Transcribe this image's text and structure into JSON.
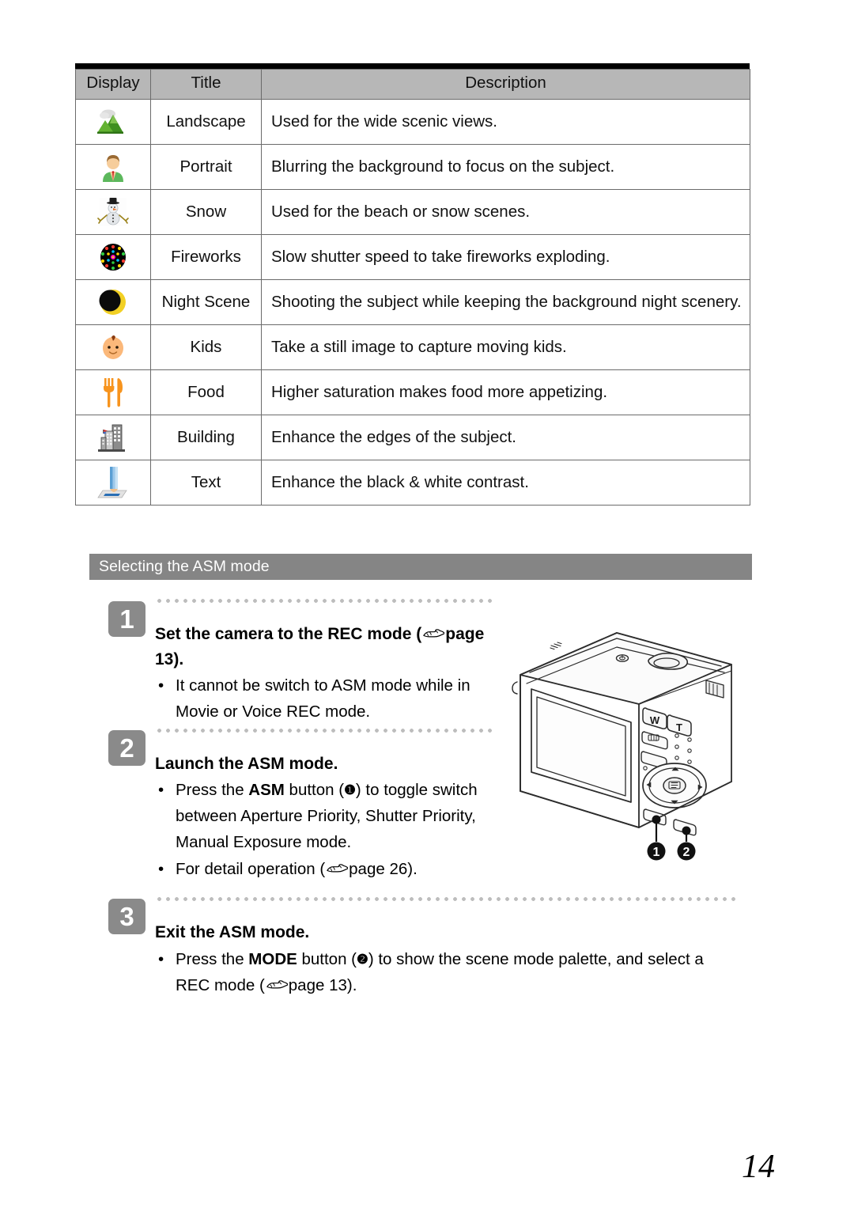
{
  "table": {
    "columns": [
      "Display",
      "Title",
      "Description"
    ],
    "rows": [
      {
        "icon": "landscape-icon",
        "title": "Landscape",
        "description": "Used for the wide scenic views."
      },
      {
        "icon": "portrait-icon",
        "title": "Portrait",
        "description": "Blurring the background to focus on the subject."
      },
      {
        "icon": "snow-icon",
        "title": "Snow",
        "description": "Used for the beach or snow scenes."
      },
      {
        "icon": "fireworks-icon",
        "title": "Fireworks",
        "description": "Slow shutter speed to take fireworks exploding."
      },
      {
        "icon": "night-scene-icon",
        "title": "Night Scene",
        "description": "Shooting the subject while keeping the background night scenery."
      },
      {
        "icon": "kids-icon",
        "title": "Kids",
        "description": "Take a still image to capture moving kids."
      },
      {
        "icon": "food-icon",
        "title": "Food",
        "description": "Higher saturation makes food more appetizing."
      },
      {
        "icon": "building-icon",
        "title": "Building",
        "description": "Enhance the edges of the subject."
      },
      {
        "icon": "text-icon",
        "title": "Text",
        "description": "Enhance the black & white contrast."
      }
    ]
  },
  "section": {
    "heading": "Selecting the ASM mode"
  },
  "steps": [
    {
      "number": "1",
      "title_part1": "Set the camera to the REC mode (",
      "title_part2": "page 13).",
      "bullets": [
        {
          "text": "It cannot be switch to ASM mode while in Movie or Voice REC mode."
        }
      ]
    },
    {
      "number": "2",
      "title_part1": "Launch the ASM mode.",
      "title_part2": "",
      "bullets": [
        {
          "pre": "Press the ",
          "strong": "ASM",
          "mid": " button (",
          "marker": "❶",
          "post": ") to toggle switch between Aperture Priority, Shutter Priority, Manual Exposure mode."
        },
        {
          "pre": "For detail operation (",
          "hand": true,
          "post": "page 26)."
        }
      ]
    },
    {
      "number": "3",
      "title_part1": "Exit the ASM mode.",
      "title_part2": "",
      "bullets": [
        {
          "pre": "Press the ",
          "strong": "MODE",
          "mid": " button (",
          "marker": "❷",
          "post": ") to show the scene mode palette, and select a REC mode (",
          "hand2": true,
          "post2": "page 13)."
        }
      ]
    }
  ],
  "camera": {
    "label_zoom_wide": "W",
    "label_zoom_tele": "T",
    "callout_1": "❶",
    "callout_2": "❷"
  },
  "page_number": "14",
  "colors": {
    "header_fill": "#b7b7b7",
    "section_bar": "#858585",
    "badge": "#8a8a8a",
    "border": "#6b6b6b",
    "top_rule": "#000000"
  }
}
